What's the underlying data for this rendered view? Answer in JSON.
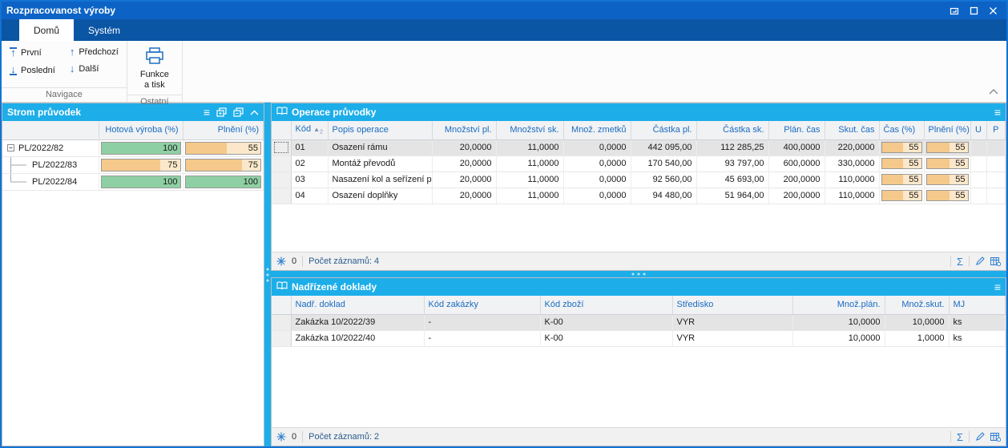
{
  "window": {
    "title": "Rozpracovanost výroby"
  },
  "tabs": {
    "home": "Domů",
    "system": "Systém"
  },
  "ribbon": {
    "nav_first": "První",
    "nav_last": "Poslední",
    "nav_prev": "Předchozí",
    "nav_next": "Další",
    "group_navigation": "Navigace",
    "func_print_line1": "Funkce",
    "func_print_line2": "a tisk",
    "group_other": "Ostatní"
  },
  "icons": {
    "menu": "≡",
    "sigma": "Σ",
    "sort_asc": "▲",
    "sort_order": "2",
    "arrow_up": "↑",
    "arrow_down": "↓"
  },
  "tree_panel": {
    "title": "Strom průvodek",
    "col_done": "Hotová výroba (%)",
    "col_fulfil": "Plnění (%)",
    "rows": [
      {
        "label": "PL/2022/82",
        "done": 100,
        "fulfil": 55
      },
      {
        "label": "PL/2022/83",
        "done": 75,
        "fulfil": 75
      },
      {
        "label": "PL/2022/84",
        "done": 100,
        "fulfil": 100
      }
    ]
  },
  "operations_panel": {
    "title": "Operace průvodky",
    "columns": {
      "code": "Kód",
      "desc": "Popis operace",
      "qty_plan": "Množství pl.",
      "qty_act": "Množství sk.",
      "qty_scrap": "Množ. zmetků",
      "amount_plan": "Částka pl.",
      "amount_act": "Částka sk.",
      "time_plan": "Plán. čas",
      "time_act": "Skut. čas",
      "time_pct": "Čas (%)",
      "fulfil_pct": "Plnění (%)",
      "u": "U",
      "p": "P"
    },
    "rows": [
      {
        "code": "01",
        "desc": "Osazení rámu",
        "qty_plan": "20,0000",
        "qty_act": "11,0000",
        "qty_scrap": "0,0000",
        "amount_plan": "442 095,00",
        "amount_act": "112 285,25",
        "time_plan": "400,0000",
        "time_act": "220,0000",
        "time_pct": 55,
        "fulfil_pct": 55
      },
      {
        "code": "02",
        "desc": "Montáž převodů",
        "qty_plan": "20,0000",
        "qty_act": "11,0000",
        "qty_scrap": "0,0000",
        "amount_plan": "170 540,00",
        "amount_act": "93 797,00",
        "time_plan": "600,0000",
        "time_act": "330,0000",
        "time_pct": 55,
        "fulfil_pct": 55
      },
      {
        "code": "03",
        "desc": "Nasazení kol a seřízení př...",
        "qty_plan": "20,0000",
        "qty_act": "11,0000",
        "qty_scrap": "0,0000",
        "amount_plan": "92 560,00",
        "amount_act": "45 693,00",
        "time_plan": "200,0000",
        "time_act": "110,0000",
        "time_pct": 55,
        "fulfil_pct": 55
      },
      {
        "code": "04",
        "desc": "Osazení doplňky",
        "qty_plan": "20,0000",
        "qty_act": "11,0000",
        "qty_scrap": "0,0000",
        "amount_plan": "94 480,00",
        "amount_act": "51 964,00",
        "time_plan": "200,0000",
        "time_act": "110,0000",
        "time_pct": 55,
        "fulfil_pct": 55
      }
    ],
    "status": {
      "marker_count": "0",
      "records": "Počet záznamů: 4"
    }
  },
  "documents_panel": {
    "title": "Nadřízené doklady",
    "columns": {
      "doc": "Nadř. doklad",
      "order_code": "Kód zakázky",
      "goods_code": "Kód zboží",
      "center": "Středisko",
      "qty_plan": "Množ.plán.",
      "qty_act": "Množ.skut.",
      "unit": "MJ"
    },
    "rows": [
      {
        "doc": "Zakázka 10/2022/39",
        "order_code": "-",
        "goods_code": "K-00",
        "center": "VYR",
        "qty_plan": "10,0000",
        "qty_act": "10,0000",
        "unit": "ks"
      },
      {
        "doc": "Zakázka 10/2022/40",
        "order_code": "-",
        "goods_code": "K-00",
        "center": "VYR",
        "qty_plan": "10,0000",
        "qty_act": "1,0000",
        "unit": "ks"
      }
    ],
    "status": {
      "marker_count": "0",
      "records": "Počet záznamů: 2"
    }
  },
  "colors": {
    "title_bar": "#0d63c5",
    "tab_strip": "#0b55a5",
    "panel_header": "#1daee9",
    "header_text": "#1a6cc0",
    "bar_orange": "#f5c98b",
    "bar_green": "#8ed0a3",
    "window_border": "#1273d3"
  }
}
